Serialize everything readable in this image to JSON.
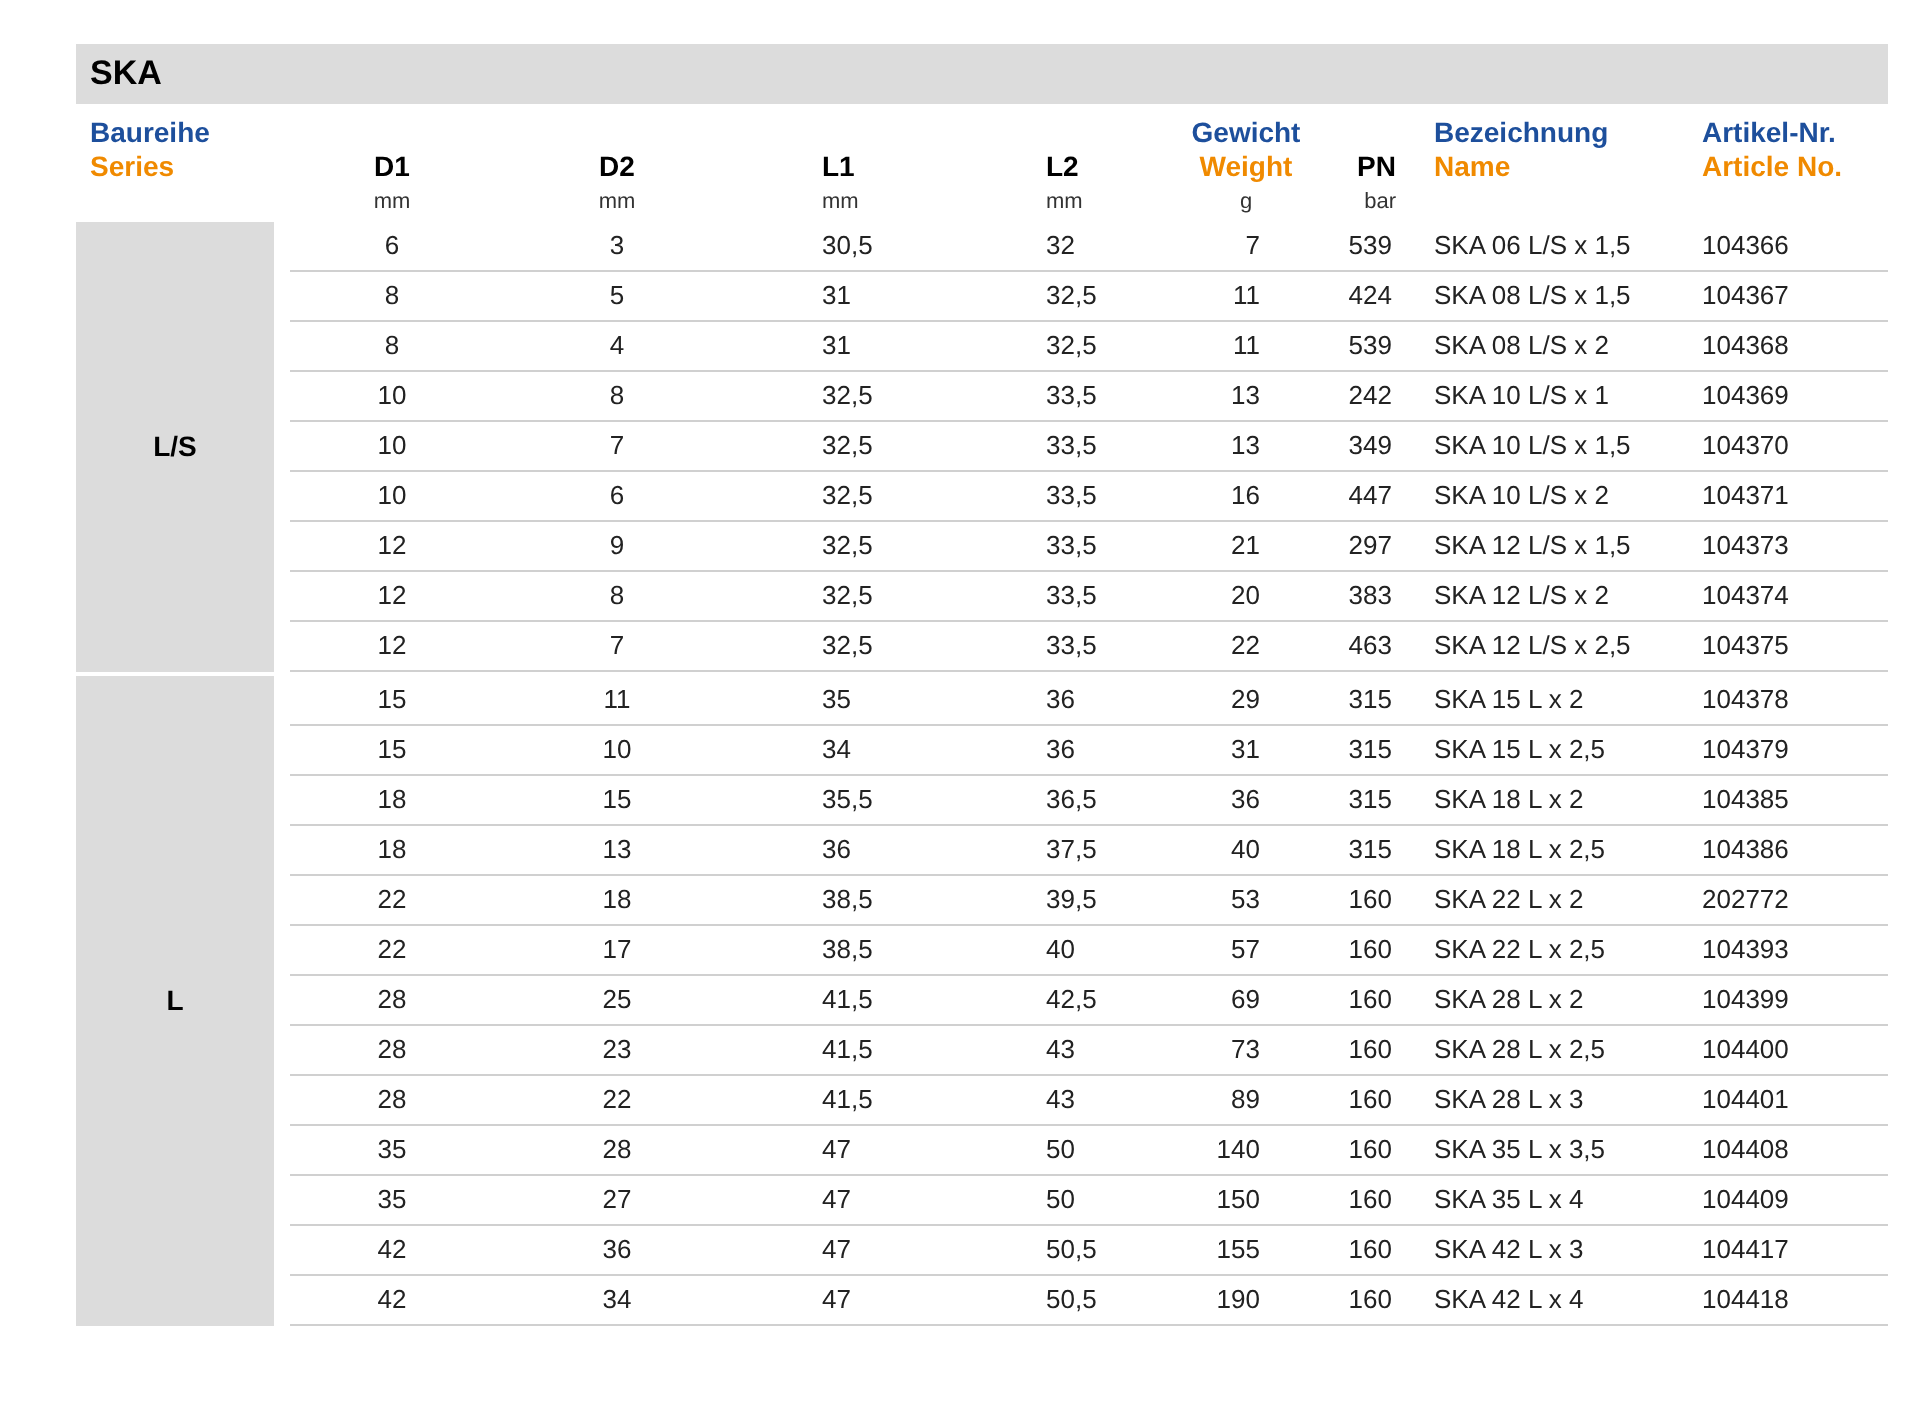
{
  "title": "SKA",
  "series_header": {
    "de": "Baureihe",
    "en": "Series"
  },
  "columns": [
    {
      "kind": "plain",
      "title": "D1",
      "unit": "mm"
    },
    {
      "kind": "plain",
      "title": "D2",
      "unit": "mm"
    },
    {
      "kind": "plain",
      "title": "L1",
      "unit": "mm"
    },
    {
      "kind": "plain",
      "title": "L2",
      "unit": "mm"
    },
    {
      "kind": "bilingual",
      "de": "Gewicht",
      "en": "Weight",
      "unit": "g"
    },
    {
      "kind": "plain",
      "title": "PN",
      "unit": "bar"
    },
    {
      "kind": "bilingual",
      "de": "Bezeichnung",
      "en": "Name"
    },
    {
      "kind": "bilingual",
      "de": "Artikel-Nr.",
      "en": "Article No."
    }
  ],
  "groups": [
    {
      "series": "L/S",
      "rows": [
        [
          "6",
          "3",
          "30,5",
          "32",
          "7",
          "539",
          "SKA 06 L/S x 1,5",
          "104366"
        ],
        [
          "8",
          "5",
          "31",
          "32,5",
          "11",
          "424",
          "SKA 08 L/S x 1,5",
          "104367"
        ],
        [
          "8",
          "4",
          "31",
          "32,5",
          "11",
          "539",
          "SKA 08 L/S x 2",
          "104368"
        ],
        [
          "10",
          "8",
          "32,5",
          "33,5",
          "13",
          "242",
          "SKA 10 L/S x 1",
          "104369"
        ],
        [
          "10",
          "7",
          "32,5",
          "33,5",
          "13",
          "349",
          "SKA 10 L/S x 1,5",
          "104370"
        ],
        [
          "10",
          "6",
          "32,5",
          "33,5",
          "16",
          "447",
          "SKA 10 L/S x 2",
          "104371"
        ],
        [
          "12",
          "9",
          "32,5",
          "33,5",
          "21",
          "297",
          "SKA 12 L/S x 1,5",
          "104373"
        ],
        [
          "12",
          "8",
          "32,5",
          "33,5",
          "20",
          "383",
          "SKA 12 L/S x 2",
          "104374"
        ],
        [
          "12",
          "7",
          "32,5",
          "33,5",
          "22",
          "463",
          "SKA 12 L/S x 2,5",
          "104375"
        ]
      ]
    },
    {
      "series": "L",
      "rows": [
        [
          "15",
          "11",
          "35",
          "36",
          "29",
          "315",
          "SKA 15 L x 2",
          "104378"
        ],
        [
          "15",
          "10",
          "34",
          "36",
          "31",
          "315",
          "SKA 15 L x 2,5",
          "104379"
        ],
        [
          "18",
          "15",
          "35,5",
          "36,5",
          "36",
          "315",
          "SKA 18 L x 2",
          "104385"
        ],
        [
          "18",
          "13",
          "36",
          "37,5",
          "40",
          "315",
          "SKA 18 L x 2,5",
          "104386"
        ],
        [
          "22",
          "18",
          "38,5",
          "39,5",
          "53",
          "160",
          "SKA 22 L x 2",
          "202772"
        ],
        [
          "22",
          "17",
          "38,5",
          "40",
          "57",
          "160",
          "SKA 22 L x 2,5",
          "104393"
        ],
        [
          "28",
          "25",
          "41,5",
          "42,5",
          "69",
          "160",
          "SKA 28 L x 2",
          "104399"
        ],
        [
          "28",
          "23",
          "41,5",
          "43",
          "73",
          "160",
          "SKA 28 L x 2,5",
          "104400"
        ],
        [
          "28",
          "22",
          "41,5",
          "43",
          "89",
          "160",
          "SKA 28 L x 3",
          "104401"
        ],
        [
          "35",
          "28",
          "47",
          "50",
          "140",
          "160",
          "SKA 35 L x 3,5",
          "104408"
        ],
        [
          "35",
          "27",
          "47",
          "50",
          "150",
          "160",
          "SKA 35 L x 4",
          "104409"
        ],
        [
          "42",
          "36",
          "47",
          "50,5",
          "155",
          "160",
          "SKA 42 L x 3",
          "104417"
        ],
        [
          "42",
          "34",
          "47",
          "50,5",
          "190",
          "160",
          "SKA 42 L x 4",
          "104418"
        ]
      ]
    }
  ]
}
